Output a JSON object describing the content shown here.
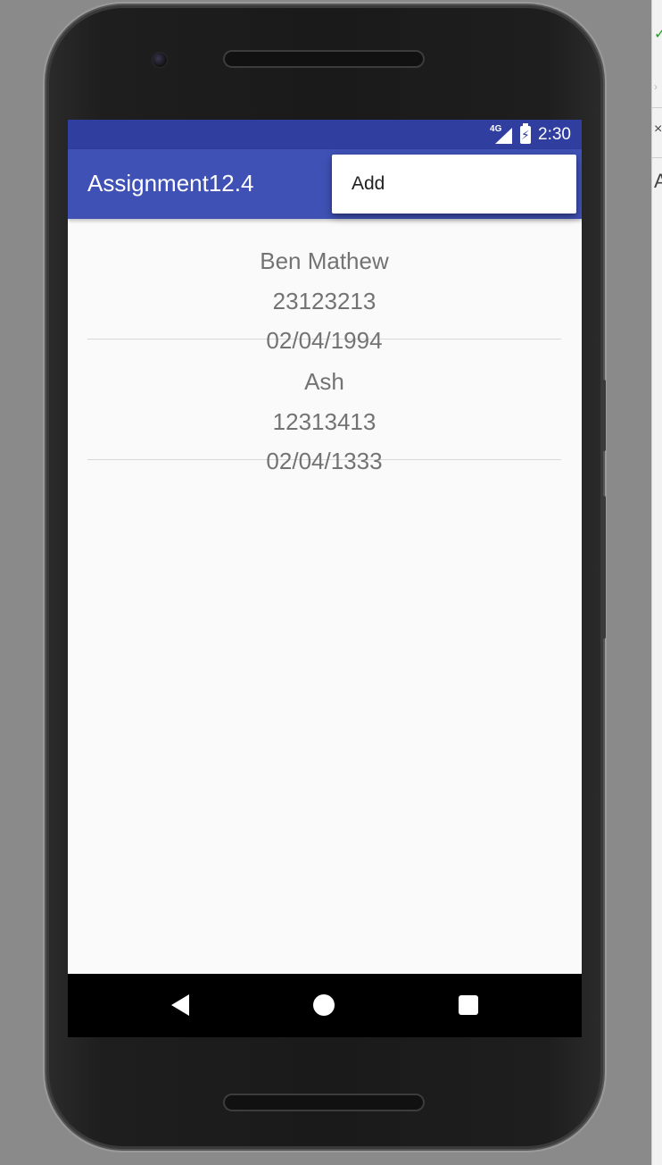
{
  "status_bar": {
    "network": "4G",
    "time": "2:30",
    "colors": {
      "background": "#303f9f"
    }
  },
  "app_bar": {
    "title": "Assignment12.4",
    "colors": {
      "background": "#3f51b5"
    }
  },
  "overflow_menu": {
    "items": [
      {
        "label": "Add"
      }
    ]
  },
  "contacts": [
    {
      "name": "Ben Mathew",
      "phone": "23123213",
      "date": "02/04/1994"
    },
    {
      "name": "Ash",
      "phone": "12313413",
      "date": "02/04/1333"
    }
  ],
  "navigation": {
    "buttons": [
      "back-icon",
      "home-icon",
      "recent-apps-icon"
    ]
  },
  "ide_side": {
    "close_glyph": "×",
    "letter": "A"
  }
}
